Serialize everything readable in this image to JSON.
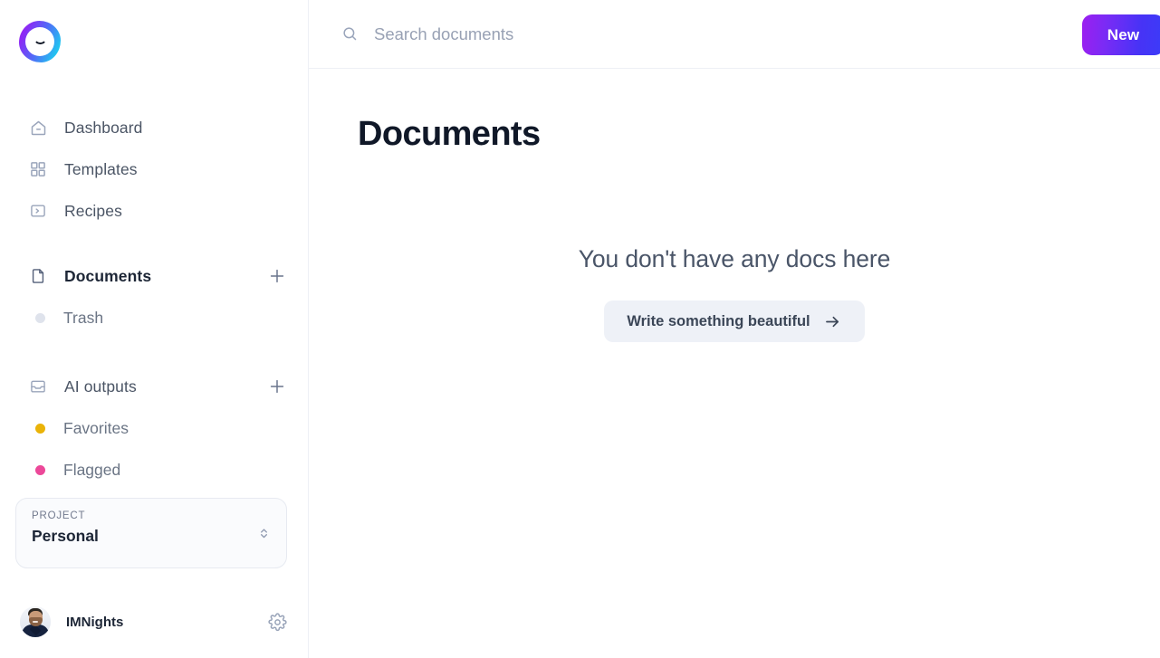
{
  "brand": {
    "logo_name": "app-logo",
    "gradient_from": "#a21cf0",
    "gradient_to": "#19cdf2"
  },
  "sidebar": {
    "nav": [
      {
        "label": "Dashboard",
        "icon": "home-icon"
      },
      {
        "label": "Templates",
        "icon": "grid-icon"
      },
      {
        "label": "Recipes",
        "icon": "terminal-icon"
      }
    ],
    "sections": [
      {
        "label": "Documents",
        "icon": "file-icon",
        "active": true,
        "add_label": "+",
        "children": [
          {
            "label": "Trash",
            "dot_color": "#dfe3ec"
          }
        ]
      },
      {
        "label": "AI outputs",
        "icon": "inbox-icon",
        "active": false,
        "add_label": "+",
        "children": [
          {
            "label": "Favorites",
            "dot_color": "#eab308"
          },
          {
            "label": "Flagged",
            "dot_color": "#ec4899"
          }
        ]
      }
    ],
    "project": {
      "label": "PROJECT",
      "value": "Personal"
    },
    "user": {
      "name": "IMNights",
      "settings_icon": "gear-icon",
      "avatar": "user-avatar"
    }
  },
  "topbar": {
    "search_placeholder": "Search documents",
    "search_value": "",
    "search_icon": "search-icon",
    "new_button": "New"
  },
  "main": {
    "title": "Documents",
    "empty_state": {
      "message": "You don't have any docs here",
      "cta_label": "Write something beautiful",
      "cta_icon": "arrow-right-icon"
    }
  }
}
